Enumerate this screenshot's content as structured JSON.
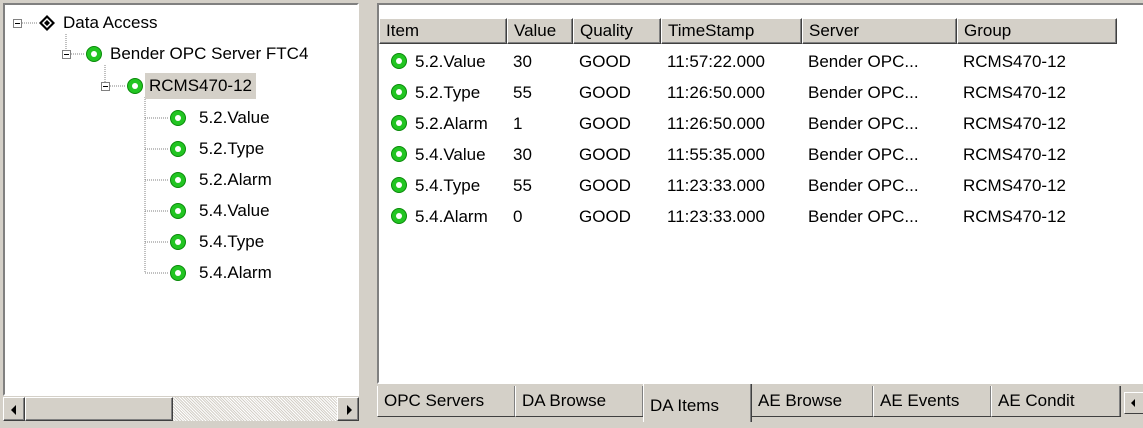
{
  "colors": {
    "status_good": "#22c522",
    "window_bg": "#d4d0c8",
    "list_bg": "#ffffff"
  },
  "tree": {
    "root": {
      "label": "Data Access",
      "icon": "diamond-icon",
      "expanded": true
    },
    "server": {
      "label": "Bender OPC Server FTC4",
      "icon": "green-status-icon",
      "expanded": true
    },
    "group": {
      "label": "RCMS470-12",
      "icon": "green-status-icon",
      "expanded": true,
      "selected": true
    },
    "items": [
      {
        "label": "5.2.Value",
        "icon": "green-status-icon"
      },
      {
        "label": "5.2.Type",
        "icon": "green-status-icon"
      },
      {
        "label": "5.2.Alarm",
        "icon": "green-status-icon"
      },
      {
        "label": "5.4.Value",
        "icon": "green-status-icon"
      },
      {
        "label": "5.4.Type",
        "icon": "green-status-icon"
      },
      {
        "label": "5.4.Alarm",
        "icon": "green-status-icon"
      }
    ]
  },
  "list": {
    "columns": [
      "Item",
      "Value",
      "Quality",
      "TimeStamp",
      "Server",
      "Group"
    ],
    "rows": [
      {
        "item": "5.2.Value",
        "value": "30",
        "quality": "GOOD",
        "timestamp": "11:57:22.000",
        "server": "Bender OPC...",
        "group": "RCMS470-12"
      },
      {
        "item": "5.2.Type",
        "value": "55",
        "quality": "GOOD",
        "timestamp": "11:26:50.000",
        "server": "Bender OPC...",
        "group": "RCMS470-12"
      },
      {
        "item": "5.2.Alarm",
        "value": "1",
        "quality": "GOOD",
        "timestamp": "11:26:50.000",
        "server": "Bender OPC...",
        "group": "RCMS470-12"
      },
      {
        "item": "5.4.Value",
        "value": "30",
        "quality": "GOOD",
        "timestamp": "11:55:35.000",
        "server": "Bender OPC...",
        "group": "RCMS470-12"
      },
      {
        "item": "5.4.Type",
        "value": "55",
        "quality": "GOOD",
        "timestamp": "11:23:33.000",
        "server": "Bender OPC...",
        "group": "RCMS470-12"
      },
      {
        "item": "5.4.Alarm",
        "value": "0",
        "quality": "GOOD",
        "timestamp": "11:23:33.000",
        "server": "Bender OPC...",
        "group": "RCMS470-12"
      }
    ]
  },
  "tabs": [
    {
      "label": "OPC Servers",
      "active": false
    },
    {
      "label": "DA Browse",
      "active": false
    },
    {
      "label": "DA Items",
      "active": true
    },
    {
      "label": "AE Browse",
      "active": false
    },
    {
      "label": "AE Events",
      "active": false
    },
    {
      "label": "AE Condit",
      "active": false
    }
  ]
}
